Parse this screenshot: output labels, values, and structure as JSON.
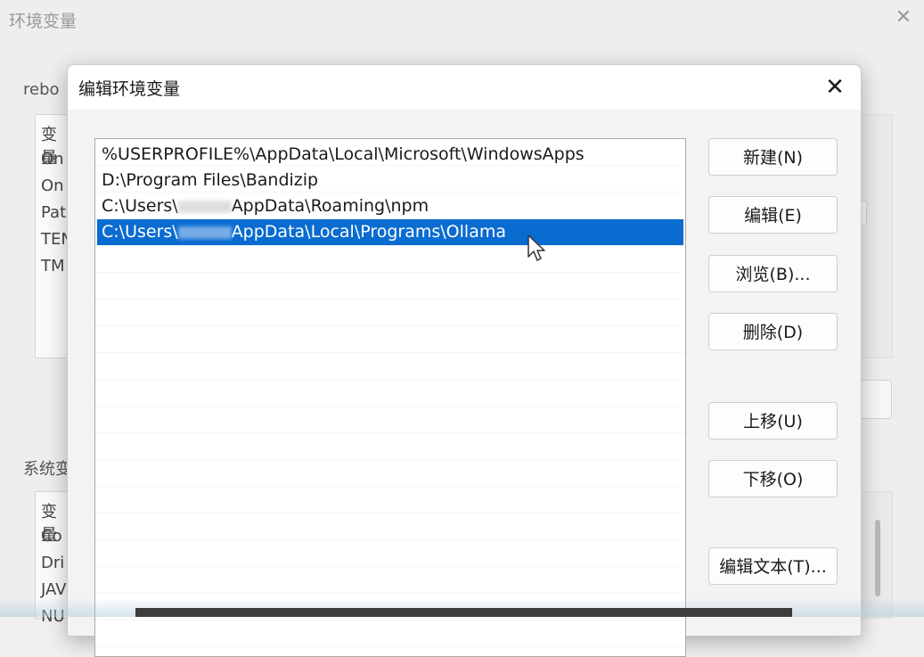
{
  "background_window": {
    "title": "环境变量",
    "close_glyph": "✕",
    "user_section_label": "rebo",
    "user_vars": [
      "变量",
      "On",
      "On",
      "Pat",
      "TEN",
      "TM"
    ],
    "system_section_label": "系统变",
    "system_vars": [
      "变量",
      "Co",
      "Dri",
      "JAV",
      "NU"
    ]
  },
  "dialog": {
    "title": "编辑环境变量",
    "close_glyph": "✕",
    "paths": [
      {
        "prefix": "%USERPROFILE%\\AppData\\Local\\Microsoft\\WindowsApps",
        "redacted": false,
        "suffix": ""
      },
      {
        "prefix": "D:\\Program Files\\Bandizip",
        "redacted": false,
        "suffix": ""
      },
      {
        "prefix": "C:\\Users\\",
        "redacted": true,
        "suffix": "AppData\\Roaming\\npm"
      },
      {
        "prefix": "C:\\Users\\",
        "redacted": true,
        "suffix": "AppData\\Local\\Programs\\Ollama"
      }
    ],
    "selected_index": 3,
    "buttons": {
      "new": "新建(N)",
      "edit": "编辑(E)",
      "browse": "浏览(B)...",
      "delete": "删除(D)",
      "move_up": "上移(U)",
      "move_down": "下移(O)",
      "edit_text": "编辑文本(T)..."
    }
  },
  "colors": {
    "selection": "#0a6cd0",
    "dialog_bg": "#f3f3f3"
  },
  "icons": {
    "cursor": "mouse-pointer-icon"
  }
}
